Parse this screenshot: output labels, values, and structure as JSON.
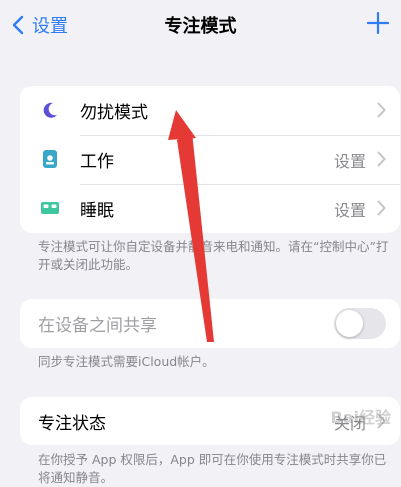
{
  "nav": {
    "back_label": "设置",
    "title": "专注模式"
  },
  "focus_list": [
    {
      "label": "勿扰模式",
      "value": "",
      "icon": "moon-icon",
      "icon_color": "#5b4fd6"
    },
    {
      "label": "工作",
      "value": "设置",
      "icon": "badge-icon",
      "icon_color": "#39a7c7"
    },
    {
      "label": "睡眠",
      "value": "设置",
      "icon": "bed-icon",
      "icon_color": "#3ec6a0"
    }
  ],
  "focus_note": "专注模式可让你自定设备并静音来电和通知。请在“控制中心”打开或关闭此功能。",
  "share": {
    "label": "在设备之间共享",
    "on": false
  },
  "share_note": "同步专注模式需要iCloud帐户。",
  "status": {
    "label": "专注状态",
    "value": "关闭"
  },
  "status_note": "在你授予 App 权限后，App 即可在你使用专注模式时共享你已将通知静音。",
  "watermark": "Bai经验",
  "colors": {
    "accent": "#2f7cf6",
    "annotation_arrow": "#e53935"
  }
}
